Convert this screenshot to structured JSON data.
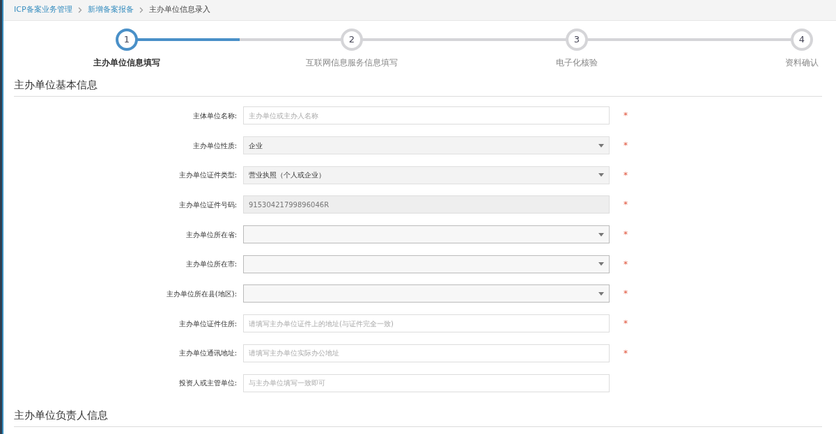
{
  "breadcrumb": [
    {
      "label": "ICP备案业务管理",
      "link": true
    },
    {
      "label": "新增备案报备",
      "link": true
    },
    {
      "label": "主办单位信息录入",
      "link": false
    }
  ],
  "steps": [
    {
      "number": "1",
      "label": "主办单位信息填写",
      "selected": true
    },
    {
      "number": "2",
      "label": "互联网信息服务信息填写",
      "selected": false
    },
    {
      "number": "3",
      "label": "电子化核验",
      "selected": false
    },
    {
      "number": "4",
      "label": "资料确认",
      "selected": false
    }
  ],
  "sections": [
    {
      "title": "主办单位基本信息",
      "fields": [
        {
          "kind": "input",
          "label": "主体单位名称:",
          "placeholder": "主办单位或主办人名称",
          "required": true,
          "required_mark": "*"
        },
        {
          "kind": "select",
          "label": "主办单位性质:",
          "value": "企业",
          "required": true,
          "required_mark": "*"
        },
        {
          "kind": "select",
          "label": "主办单位证件类型:",
          "value": "营业执照（个人或企业）",
          "required": true,
          "required_mark": "*"
        },
        {
          "kind": "readonly",
          "label": "主办单位证件号码:",
          "value": "91530421799896046R",
          "required": true,
          "required_mark": "*"
        },
        {
          "kind": "select",
          "label": "主办单位所在省:",
          "required": true,
          "required_mark": "*"
        },
        {
          "kind": "select",
          "label": "主办单位所在市:",
          "required": true,
          "required_mark": "*"
        },
        {
          "kind": "select",
          "label": "主办单位所在县(地区):",
          "required": true,
          "required_mark": "*"
        },
        {
          "kind": "input",
          "label": "主办单位证件住所:",
          "placeholder": "请填写主办单位证件上的地址(与证件完全一致)",
          "required": true,
          "required_mark": "*"
        },
        {
          "kind": "input",
          "label": "主办单位通讯地址:",
          "placeholder": "请填写主办单位实际办公地址",
          "required": true,
          "required_mark": "*"
        },
        {
          "kind": "input",
          "label": "投资人或主管单位:",
          "placeholder": "与主办单位填写一致即可",
          "required": false
        }
      ]
    },
    {
      "title": "主办单位负责人信息"
    }
  ]
}
